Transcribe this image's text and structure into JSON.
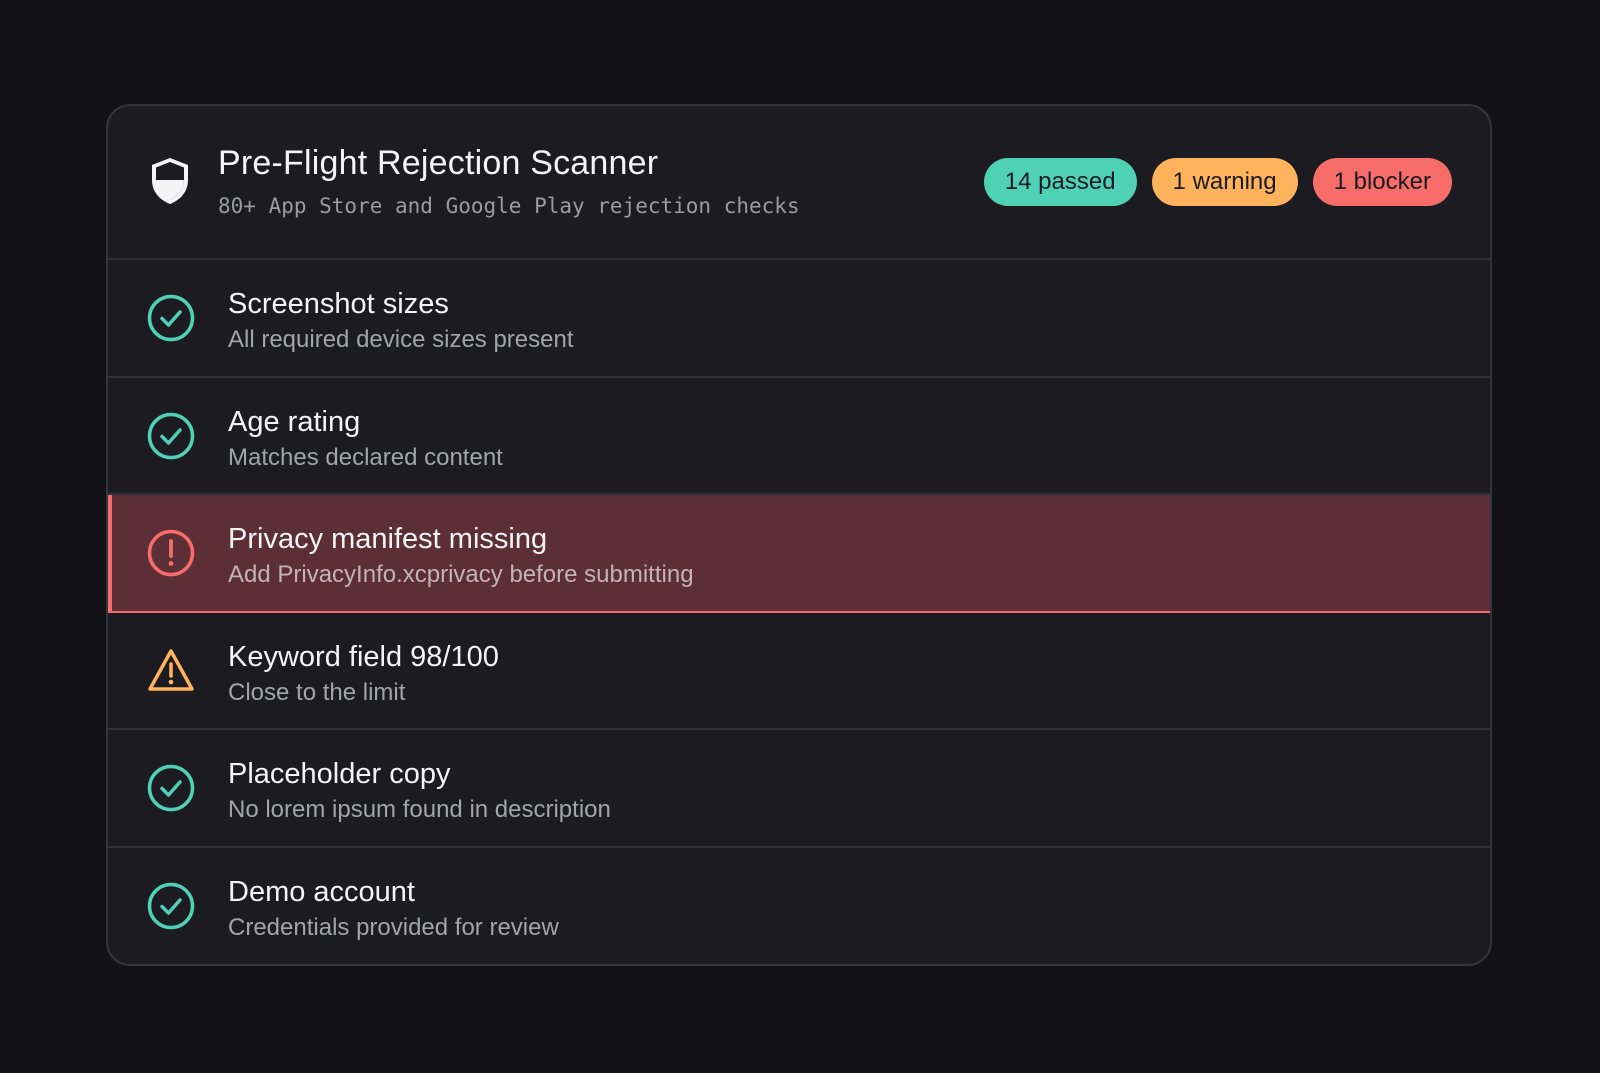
{
  "header": {
    "icon": "shield-icon",
    "title": "Pre-Flight Rejection Scanner",
    "subtitle": "80+ App Store and Google Play rejection checks"
  },
  "badges": {
    "passed": "14 passed",
    "warning": "1 warning",
    "blocker": "1 blocker"
  },
  "colors": {
    "pass": "#4fd1b5",
    "warning": "#ffb35c",
    "blocker": "#f76d6a",
    "blocker_row_bg": "#5c2e35",
    "card_bg": "#1b1b21",
    "page_bg": "#111116"
  },
  "checks": [
    {
      "status": "pass",
      "icon": "check-circle-icon",
      "title": "Screenshot sizes",
      "description": "All required device sizes present"
    },
    {
      "status": "pass",
      "icon": "check-circle-icon",
      "title": "Age rating",
      "description": "Matches declared content"
    },
    {
      "status": "blocker",
      "icon": "alert-circle-icon",
      "title": "Privacy manifest missing",
      "description": "Add PrivacyInfo.xcprivacy before submitting"
    },
    {
      "status": "warning",
      "icon": "warning-triangle-icon",
      "title": "Keyword field 98/100",
      "description": "Close to the limit"
    },
    {
      "status": "pass",
      "icon": "check-circle-icon",
      "title": "Placeholder copy",
      "description": "No lorem ipsum found in description"
    },
    {
      "status": "pass",
      "icon": "check-circle-icon",
      "title": "Demo account",
      "description": "Credentials provided for review"
    }
  ]
}
